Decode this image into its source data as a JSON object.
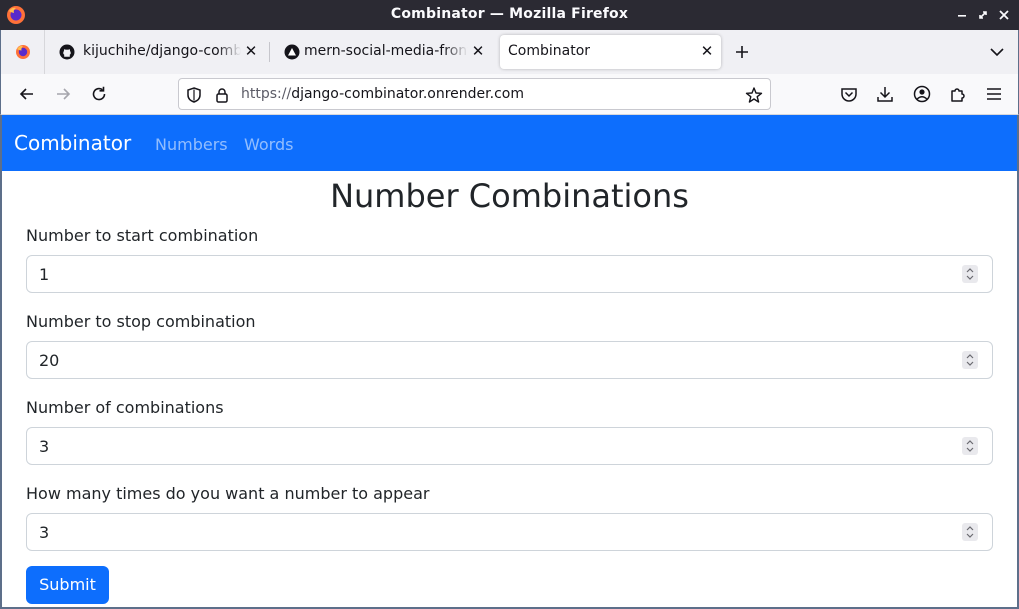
{
  "window": {
    "title": "Combinator — Mozilla Firefox"
  },
  "tabs": [
    {
      "label": "kijuchihe/django-combinator",
      "icon": "github-icon"
    },
    {
      "label": "mern-social-media-frontend",
      "icon": "vercel-icon"
    },
    {
      "label": "Combinator",
      "active": true
    }
  ],
  "address_bar": {
    "scheme": "https://",
    "host": "django-combinator.onrender.com"
  },
  "site": {
    "brand": "Combinator",
    "nav": [
      "Numbers",
      "Words"
    ],
    "accent_color": "#0d6efd"
  },
  "form": {
    "heading": "Number Combinations",
    "fields": [
      {
        "label": "Number to start combination",
        "value": "1"
      },
      {
        "label": "Number to stop combination",
        "value": "20"
      },
      {
        "label": "Number of combinations",
        "value": "3"
      },
      {
        "label": "How many times do you want a number to appear",
        "value": "3"
      }
    ],
    "submit_label": "Submit"
  }
}
